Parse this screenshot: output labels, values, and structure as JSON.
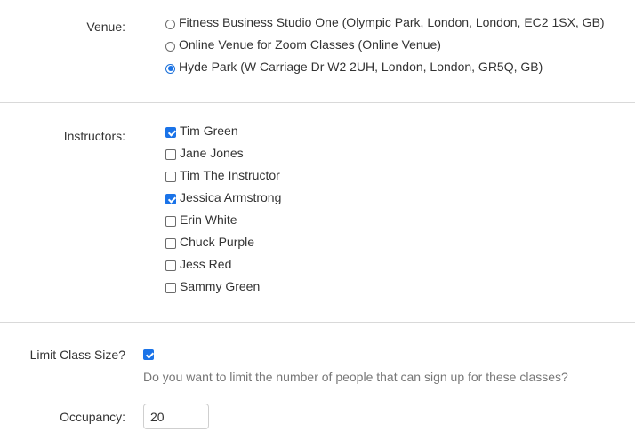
{
  "venue": {
    "label": "Venue:",
    "options": [
      {
        "label": "Fitness Business Studio One (Olympic Park, London, London, EC2 1SX, GB)",
        "selected": false
      },
      {
        "label": "Online Venue for Zoom Classes (Online Venue)",
        "selected": false
      },
      {
        "label": "Hyde Park (W Carriage Dr W2 2UH, London, London, GR5Q, GB)",
        "selected": true
      }
    ]
  },
  "instructors": {
    "label": "Instructors:",
    "items": [
      {
        "label": "Tim Green",
        "checked": true
      },
      {
        "label": "Jane Jones",
        "checked": false
      },
      {
        "label": "Tim The Instructor",
        "checked": false
      },
      {
        "label": "Jessica Armstrong",
        "checked": true
      },
      {
        "label": "Erin White",
        "checked": false
      },
      {
        "label": "Chuck Purple",
        "checked": false
      },
      {
        "label": "Jess Red",
        "checked": false
      },
      {
        "label": "Sammy Green",
        "checked": false
      }
    ]
  },
  "limit_class_size": {
    "label": "Limit Class Size?",
    "checked": true,
    "help": "Do you want to limit the number of people that can sign up for these classes?"
  },
  "occupancy": {
    "label": "Occupancy:",
    "value": "20"
  },
  "colors": {
    "accent": "#1a73e8",
    "divider": "#d9d9d9",
    "help_text": "#777777"
  }
}
